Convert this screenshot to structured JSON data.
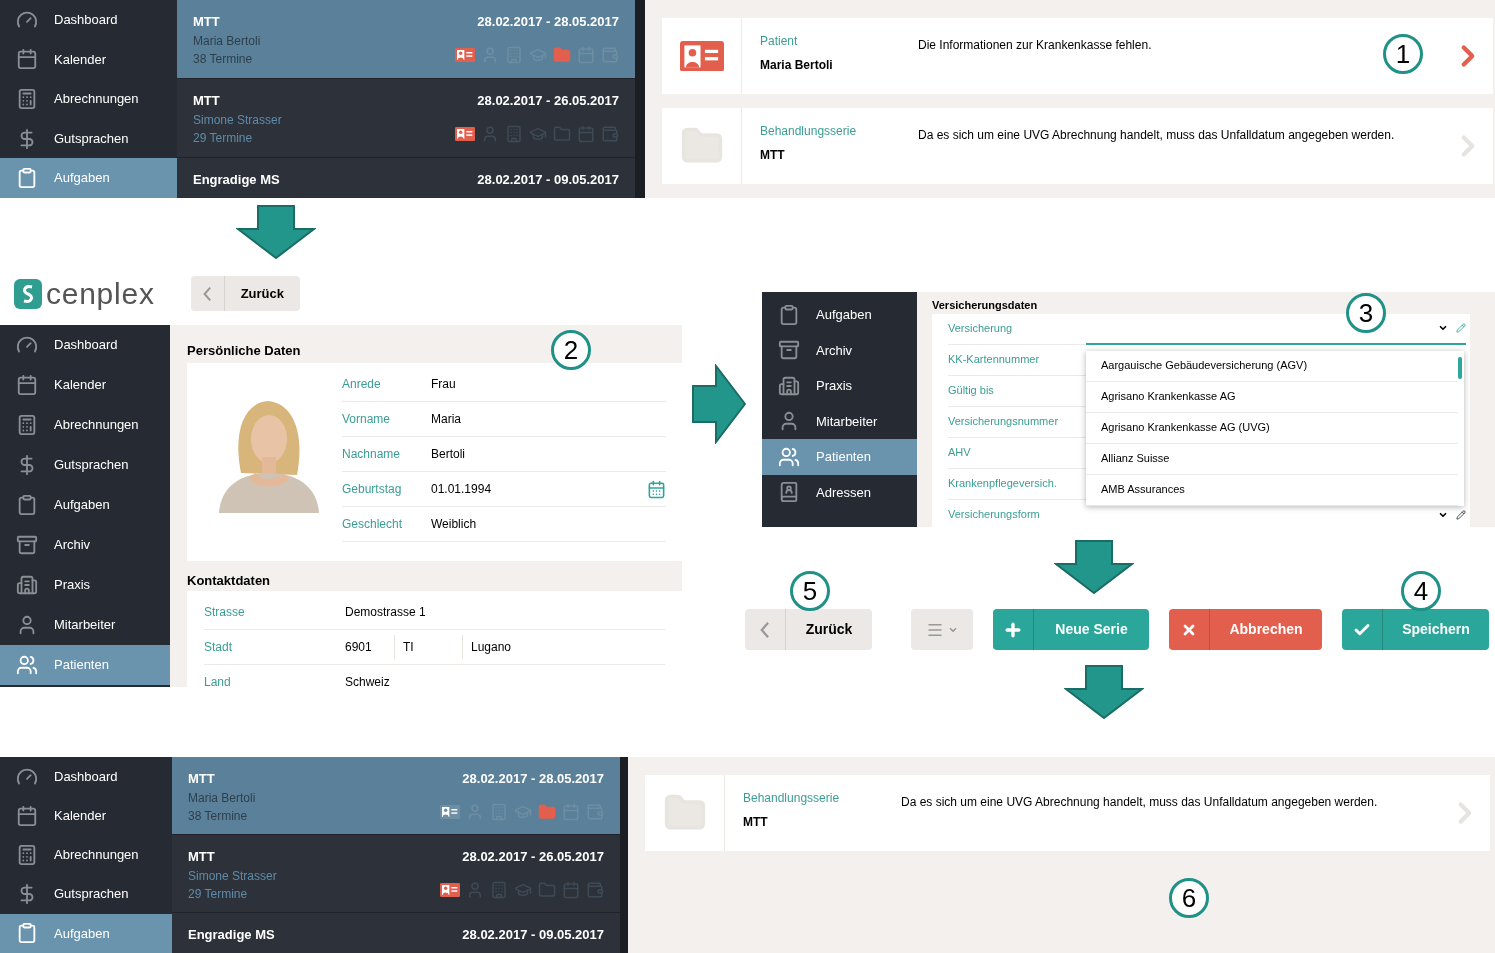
{
  "before": {
    "step": "1",
    "sidebar": [
      {
        "kind": "dashboard",
        "label": "Dashboard",
        "selected": false
      },
      {
        "kind": "calendar",
        "label": "Kalender",
        "selected": false
      },
      {
        "kind": "billing",
        "label": "Abrechnungen",
        "selected": false
      },
      {
        "kind": "guarantee",
        "label": "Gutsprachen",
        "selected": false
      },
      {
        "kind": "tasks",
        "label": "Aufgaben",
        "selected": true
      }
    ],
    "tasks": [
      {
        "title": "MTT",
        "dates": "28.02.2017 - 28.05.2017",
        "patient": "Maria Bertoli",
        "appointments": "38 Termine",
        "selected": true,
        "status": [
          {
            "flagged": true
          },
          {
            "flagged": false
          },
          {
            "flagged": false
          },
          {
            "flagged": false
          },
          {
            "flagged": true
          },
          {
            "flagged": false
          },
          {
            "flagged": false
          }
        ]
      },
      {
        "title": "MTT",
        "dates": "28.02.2017 - 26.05.2017",
        "patient": "Simone Strasser",
        "appointments": "29 Termine",
        "selected": false,
        "status": [
          {
            "flagged": true
          },
          {
            "flagged": false
          },
          {
            "flagged": false
          },
          {
            "flagged": false
          },
          {
            "flagged": false
          },
          {
            "flagged": false
          },
          {
            "flagged": false
          }
        ]
      },
      {
        "title": "Engradige MS",
        "dates": "28.02.2017 - 09.05.2017",
        "selected": false
      }
    ],
    "issues": [
      {
        "kind": "patient",
        "category": "Patient",
        "name": "Maria Bertoli",
        "message": "Die Informationen zur Krankenkasse fehlen.",
        "active": true
      },
      {
        "kind": "series",
        "category": "Behandlungsserie",
        "name": "MTT",
        "message": "Da es sich um eine UVG Abrechnung handelt, muss das Unfalldatum angegeben werden.",
        "active": false
      }
    ]
  },
  "patient_form": {
    "step": "2",
    "logo": "cenplex",
    "back_button": "Zurück",
    "sidebar": [
      {
        "kind": "dashboard",
        "label": "Dashboard",
        "selected": false
      },
      {
        "kind": "calendar",
        "label": "Kalender",
        "selected": false
      },
      {
        "kind": "billing",
        "label": "Abrechnungen",
        "selected": false
      },
      {
        "kind": "guarantee",
        "label": "Gutsprachen",
        "selected": false
      },
      {
        "kind": "tasks",
        "label": "Aufgaben",
        "selected": false
      },
      {
        "kind": "archive",
        "label": "Archiv",
        "selected": false
      },
      {
        "kind": "practice",
        "label": "Praxis",
        "selected": false
      },
      {
        "kind": "staff",
        "label": "Mitarbeiter",
        "selected": false
      },
      {
        "kind": "patients",
        "label": "Patienten",
        "selected": true
      }
    ],
    "personal": {
      "title": "Persönliche Daten",
      "fields": [
        {
          "label": "Anrede",
          "value": "Frau",
          "kind": "text"
        },
        {
          "label": "Vorname",
          "value": "Maria",
          "kind": "text"
        },
        {
          "label": "Nachname",
          "value": "Bertoli",
          "kind": "text"
        },
        {
          "label": "Geburtstag",
          "value": "01.01.1994",
          "kind": "date"
        },
        {
          "label": "Geschlecht",
          "value": "Weiblich",
          "kind": "text"
        }
      ]
    },
    "contact": {
      "title": "Kontaktdaten",
      "fields": [
        {
          "label": "Strasse",
          "values": [
            "Demostrasse 1"
          ]
        },
        {
          "label": "Stadt",
          "values": [
            "6901",
            "TI",
            "Lugano"
          ]
        },
        {
          "label": "Land",
          "values": [
            "Schweiz"
          ]
        }
      ]
    }
  },
  "insurance_form": {
    "step": "3",
    "sidebar": [
      {
        "kind": "tasks",
        "label": "Aufgaben",
        "selected": false
      },
      {
        "kind": "archive",
        "label": "Archiv",
        "selected": false
      },
      {
        "kind": "practice",
        "label": "Praxis",
        "selected": false
      },
      {
        "kind": "staff",
        "label": "Mitarbeiter",
        "selected": false
      },
      {
        "kind": "patients",
        "label": "Patienten",
        "selected": true
      },
      {
        "kind": "addresses",
        "label": "Adressen",
        "selected": false
      }
    ],
    "title": "Versicherungsdaten",
    "fields": [
      {
        "label": "Versicherung",
        "kind": "dropdown",
        "expanded": true
      },
      {
        "label": "KK-Kartennummer",
        "kind": "text"
      },
      {
        "label": "Gültig bis",
        "kind": "text"
      },
      {
        "label": "Versicherungsnummer",
        "kind": "text"
      },
      {
        "label": "AHV",
        "kind": "text"
      },
      {
        "label": "Krankenpflegeversich.",
        "kind": "text"
      },
      {
        "label": "Versicherungsform",
        "kind": "dropdown",
        "expanded": false
      }
    ],
    "options": [
      "Aargauische Gebäudeversicherung (AGV)",
      "Agrisano Krankenkasse AG",
      "Agrisano Krankenkasse AG (UVG)",
      "Allianz Suisse",
      "AMB Assurances"
    ]
  },
  "actions": [
    {
      "kind": "back",
      "label": "Zurück",
      "step": "5"
    },
    {
      "kind": "menu"
    },
    {
      "kind": "add",
      "label": "Neue Serie"
    },
    {
      "kind": "cancel",
      "label": "Abbrechen"
    },
    {
      "kind": "save",
      "label": "Speichern",
      "step": "4"
    }
  ],
  "after": {
    "step": "6",
    "sidebar": [
      {
        "kind": "dashboard",
        "label": "Dashboard",
        "selected": false
      },
      {
        "kind": "calendar",
        "label": "Kalender",
        "selected": false
      },
      {
        "kind": "billing",
        "label": "Abrechnungen",
        "selected": false
      },
      {
        "kind": "guarantee",
        "label": "Gutsprachen",
        "selected": false
      },
      {
        "kind": "tasks",
        "label": "Aufgaben",
        "selected": true
      }
    ],
    "tasks": [
      {
        "title": "MTT",
        "dates": "28.02.2017 - 28.05.2017",
        "patient": "Maria Bertoli",
        "appointments": "38 Termine",
        "selected": true,
        "status": [
          {
            "flagged": false
          },
          {
            "flagged": false
          },
          {
            "flagged": false
          },
          {
            "flagged": false
          },
          {
            "flagged": true
          },
          {
            "flagged": false
          },
          {
            "flagged": false
          }
        ]
      },
      {
        "title": "MTT",
        "dates": "28.02.2017 - 26.05.2017",
        "patient": "Simone Strasser",
        "appointments": "29 Termine",
        "selected": false,
        "status": [
          {
            "flagged": true
          },
          {
            "flagged": false
          },
          {
            "flagged": false
          },
          {
            "flagged": false
          },
          {
            "flagged": false
          },
          {
            "flagged": false
          },
          {
            "flagged": false
          }
        ]
      },
      {
        "title": "Engradige MS",
        "dates": "28.02.2017 - 09.05.2017",
        "selected": false
      }
    ],
    "issues": [
      {
        "kind": "series",
        "category": "Behandlungsserie",
        "name": "MTT",
        "message": "Da es sich um eine UVG Abrechnung handelt, muss das Unfalldatum angegeben werden.",
        "active": false
      }
    ]
  }
}
